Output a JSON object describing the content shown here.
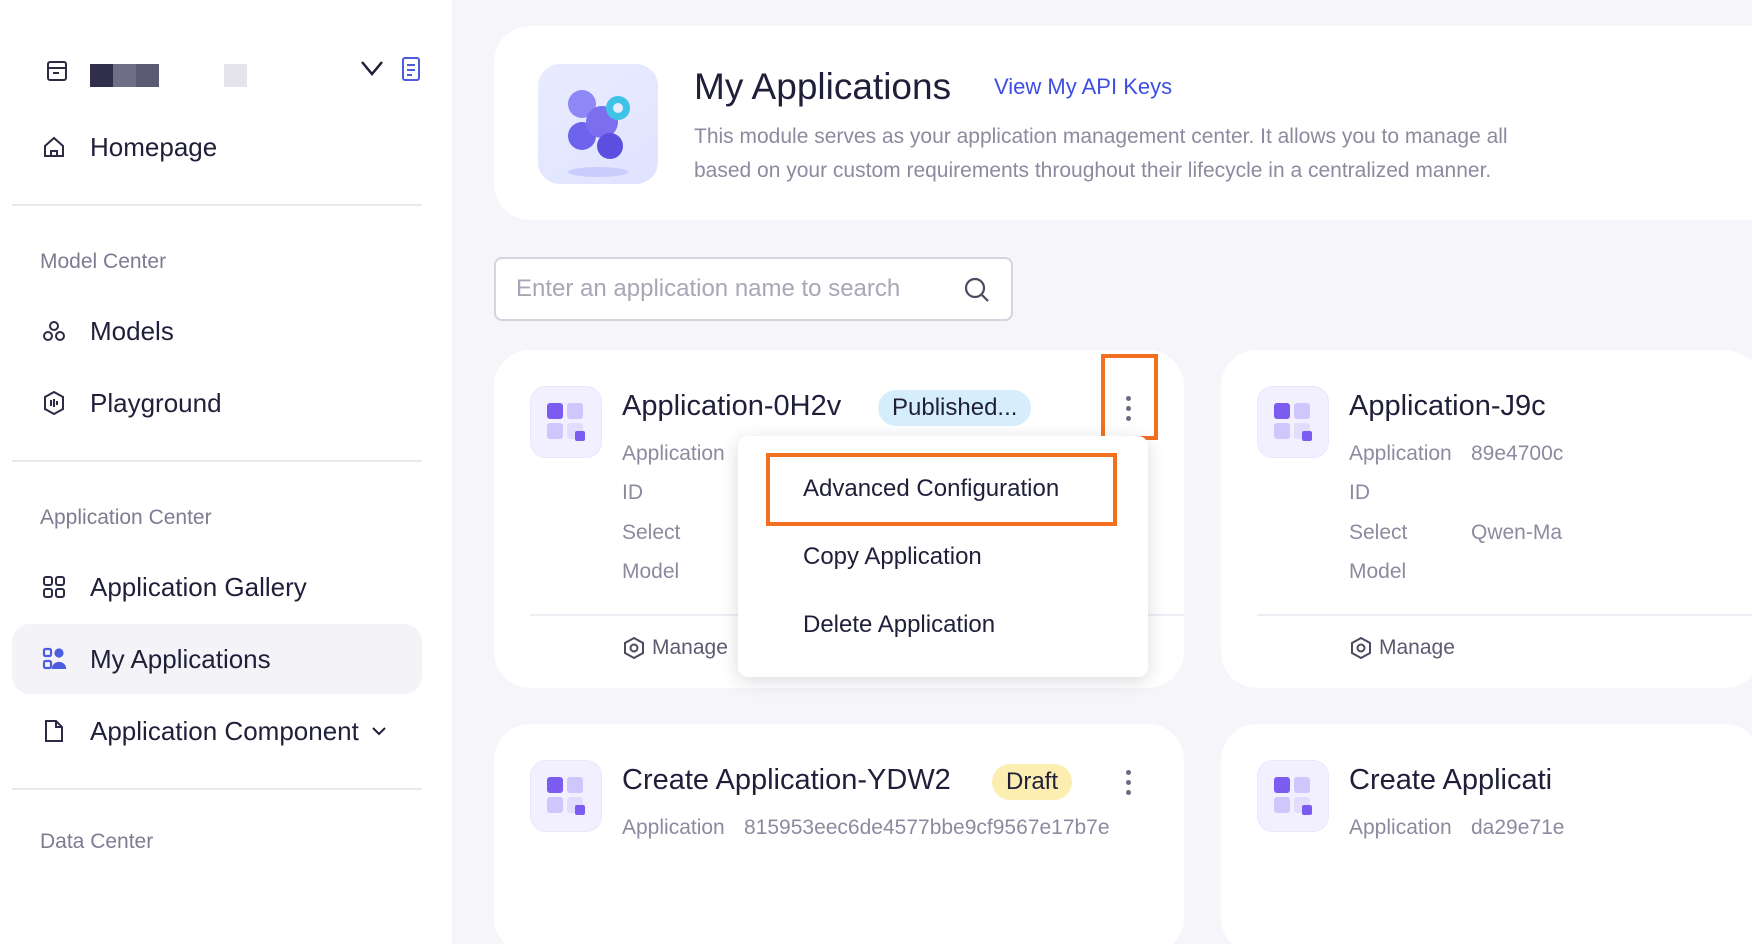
{
  "sidebar": {
    "homepage": "Homepage",
    "model_center": "Model Center",
    "models": "Models",
    "playground": "Playground",
    "application_center": "Application Center",
    "app_gallery": "Application Gallery",
    "my_applications": "My Applications",
    "app_component": "Application Component",
    "data_center": "Data Center"
  },
  "header": {
    "title": "My Applications",
    "api_link": "View My API Keys",
    "desc_line1": "This module serves as your application management center. It allows you to manage all",
    "desc_line2": "based on your custom requirements throughout their lifecycle in a centralized manner."
  },
  "search": {
    "placeholder": "Enter an application name to search",
    "value": ""
  },
  "cards": [
    {
      "title": "Application-0H2v",
      "status": "Published...",
      "meta_app": "Application",
      "meta_id": "ID",
      "meta_select": "Select",
      "meta_model": "Model",
      "manage": "Manage"
    },
    {
      "title": "Application-J9c",
      "meta_app": "Application",
      "app_id": "89e4700c",
      "meta_id": "ID",
      "meta_select": "Select",
      "model": "Qwen-Ma",
      "meta_model": "Model",
      "manage": "Manage"
    },
    {
      "title": "Create Application-YDW2",
      "status": "Draft",
      "meta_app": "Application",
      "app_id": "815953eec6de4577bbe9cf9567e17b7e"
    },
    {
      "title": "Create Applicati",
      "meta_app": "Application",
      "app_id": "da29e71e"
    }
  ],
  "menu": {
    "advanced": "Advanced Configuration",
    "copy": "Copy Application",
    "delete": "Delete Application"
  },
  "colors": {
    "accent": "#3e4fe0",
    "highlight": "#f37021",
    "draft_badge": "#fcedb0",
    "published_badge": "#d6eefc"
  }
}
